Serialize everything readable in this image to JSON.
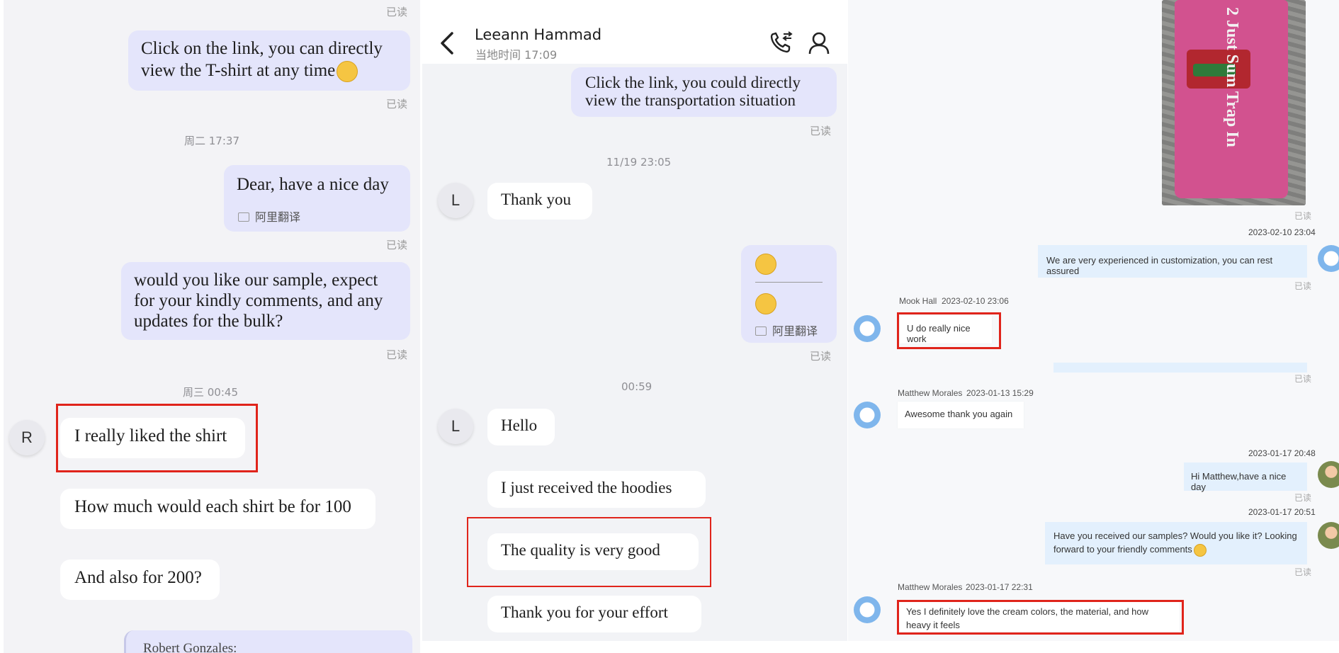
{
  "read_label": "已读",
  "left": {
    "msg1": "Click on the link, you can directly view the T-shirt at any time",
    "time1": "周二 17:37",
    "msg2": "Dear, have a nice day",
    "msg2_translate": "阿里翻译",
    "msg3": "would you like our sample, expect for your kindly comments, and any updates for the bulk?",
    "time2": "周三 00:45",
    "avatar_letter": "R",
    "in1": "I really liked the shirt",
    "in2": "How much would each shirt be for 100",
    "in3": "And also for 200?",
    "quote_name": "Robert Gonzales:"
  },
  "mid": {
    "contact_name": "Leeann Hammad",
    "local_time": "当地时间 17:09",
    "msg_link": "Click the link, you could directly view the transportation situation",
    "time1": "11/19 23:05",
    "avatar_letter": "L",
    "in1": "Thank you",
    "translate_label": "阿里翻译",
    "time2": "00:59",
    "in2": "Hello",
    "in3": "I just received the hoodies",
    "in4": "The quality is very good",
    "in5": "Thank you for your effort"
  },
  "right": {
    "date1": "2023-02-10 23:04",
    "out1": "We are very experienced in customization, you can rest assured",
    "sender1": "Mook Hall",
    "sender1_time": "2023-02-10 23:06",
    "in1": "U do really nice work",
    "sender2": "Matthew Morales",
    "sender2_time": "2023-01-13 15:29",
    "in2": "Awesome thank you again",
    "date2": "2023-01-17 20:48",
    "out2": "Hi Matthew,have a nice day",
    "date3": "2023-01-17 20:51",
    "out3": "Have you received our samples? Would you like it? Looking forward to your friendly comments",
    "sender3": "Matthew Morales",
    "sender3_time": "2023-01-17 22:31",
    "in3": "Yes I definitely love the cream colors, the material, and how heavy it feels",
    "shirt_text": "2 Just Sum Trap In"
  },
  "colors": {
    "highlight": "#e0241b",
    "outgoing_bubble": "#e4e5fb",
    "right_outgoing_bubble": "#e3f0fd"
  },
  "icons": [
    "back-arrow-icon",
    "phone-icon",
    "profile-icon",
    "translate-icon",
    "emoji-icon"
  ]
}
